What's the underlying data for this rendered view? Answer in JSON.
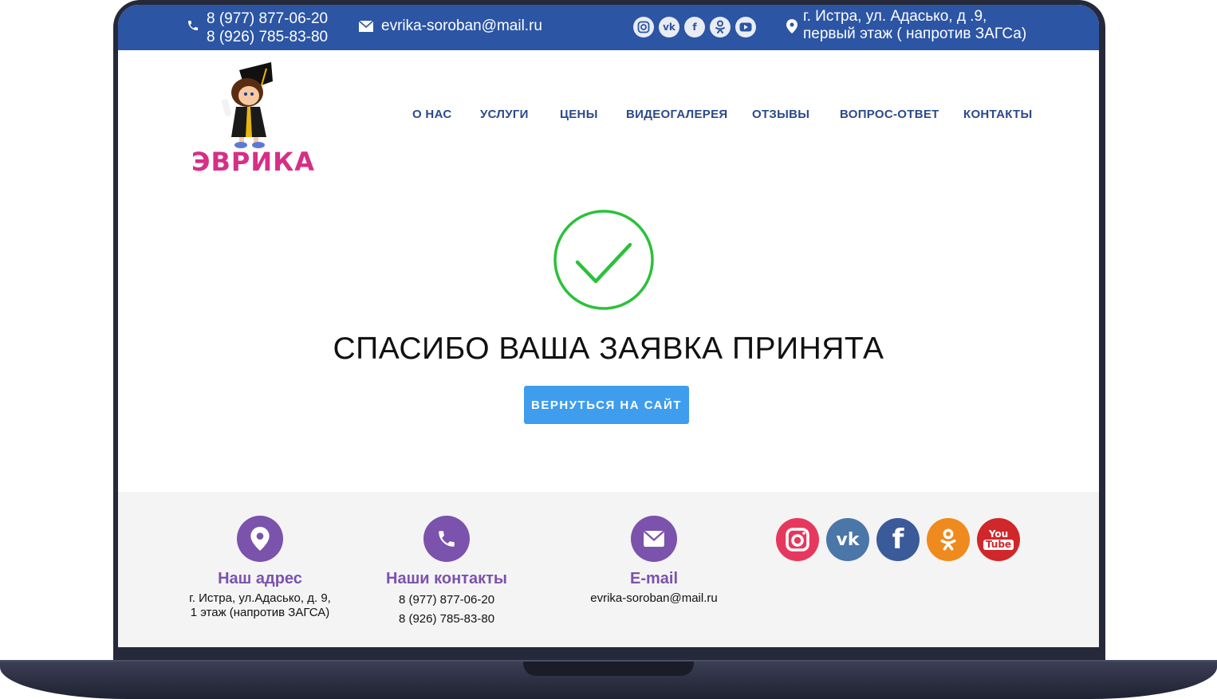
{
  "topbar": {
    "phone1": "8 (977) 877-06-20",
    "phone2": "8 (926) 785-83-80",
    "email": "evrika-soroban@mail.ru",
    "social_icons": [
      "instagram-icon",
      "vk-icon",
      "facebook-icon",
      "odnoklassniki-icon",
      "youtube-icon"
    ],
    "address_line1": "г. Истра, ул. Адасько, д .9,",
    "address_line2": "первый этаж ( напротив ЗАГСа)"
  },
  "logo": {
    "text": "ЭВРИКА"
  },
  "nav": {
    "items": [
      "О НАС",
      "УСЛУГИ",
      "ЦЕНЫ",
      "ВИДЕОГАЛЕРЕЯ",
      "ОТЗЫВЫ",
      "ВОПРОС-ОТВЕТ",
      "КОНТАКТЫ"
    ]
  },
  "main": {
    "message": "СПАСИБО ВАША ЗАЯВКА ПРИНЯТА",
    "button": "ВЕРНУТЬСЯ НА САЙТ"
  },
  "footer": {
    "address": {
      "title": "Наш адрес",
      "line1": "г. Истра, ул.Адасько, д. 9,",
      "line2": "1 этаж (напротив ЗАГСА)"
    },
    "contacts": {
      "title": "Наши контакты",
      "phone1": "8 (977) 877-06-20",
      "phone2": "8 (926) 785-83-80"
    },
    "email": {
      "title": "E-mail",
      "value": "evrika-soroban@mail.ru"
    },
    "social": {
      "instagram_color": "#e6385e",
      "vk_color": "#4a76a8",
      "facebook_color": "#3b5a9a",
      "odnoklassniki_color": "#ef8a1e",
      "youtube_color": "#d0272b",
      "youtube_label_1": "You",
      "youtube_label_2": "Tube"
    }
  },
  "colors": {
    "topbar": "#2c55a4",
    "nav_text": "#2c4a8a",
    "brand_pink": "#d62f86",
    "check_green": "#2bc13a",
    "button_blue": "#3e9ded",
    "footer_purple": "#7b52ac"
  }
}
